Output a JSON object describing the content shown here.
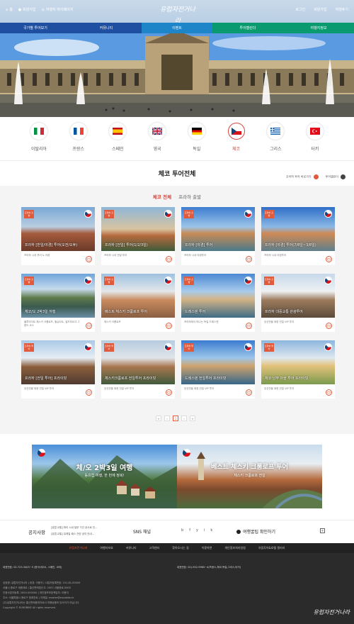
{
  "header": {
    "util_left": [
      "홈",
      "회원가입",
      "여행자 마이페이지"
    ],
    "logo_text": "유럽자전거나라",
    "util_right": [
      "로그인",
      "회원가입",
      "여행후기"
    ]
  },
  "gnb": {
    "items": [
      {
        "label": "국가별 투어보기",
        "color": "#1f4fa0"
      },
      {
        "label": "커뮤니티",
        "color": "#1f4fa0"
      },
      {
        "label": "이벤트",
        "color": "#1e86c8"
      },
      {
        "label": "투어캘린더",
        "color": "#0a9a6f"
      },
      {
        "label": "여행지정보",
        "color": "#0a9a6f"
      }
    ]
  },
  "countries": [
    {
      "label": "이탈리아",
      "active": false
    },
    {
      "label": "프랑스",
      "active": false
    },
    {
      "label": "스페인",
      "active": false
    },
    {
      "label": "영국",
      "active": false
    },
    {
      "label": "독일",
      "active": false
    },
    {
      "label": "체코",
      "active": true
    },
    {
      "label": "그리스",
      "active": false
    },
    {
      "label": "터키",
      "active": false
    }
  ],
  "section_title": "체코 투어전체",
  "top_links": {
    "link1": "프라하 투어 바로가기",
    "link2": "투어캘린더"
  },
  "filter": {
    "tab_all": "체코 전체",
    "tab_prague": "프라하 출발"
  },
  "cards": [
    {
      "badge": "프라하 출발",
      "title": "프라하 [반일/야경] 투어(오전/오후)",
      "sub": "프라하 시내 투어 & 야경"
    },
    {
      "badge": "프라하 출발",
      "title": "프라하 [전일] 투어(1/2/3일)",
      "sub": "프라하 시내 전일 투어"
    },
    {
      "badge": "프라하 출발",
      "title": "프라하 [야경] 투어",
      "sub": "프라하 시내 야경투어"
    },
    {
      "badge": "프라하 출발",
      "title": "프라하 [야경] 투어(7/8일~3/8일)",
      "sub": "프라하 시내 야경투어"
    },
    {
      "badge": "프라하 출발",
      "title": "체코/오 2박3일 여행",
      "sub": "블루라이트 체스키 크룸로프, 할슈타트, 잘츠부르크 그랜드 코스"
    },
    {
      "badge": "프라하 출발",
      "title": "베스트 체스키 크룸로프 투어",
      "sub": "체스키 크룸로프"
    },
    {
      "badge": "프라하 출발",
      "title": "드레스덴 투어",
      "sub": "프라하에서 떠나는 독일 드레스덴"
    },
    {
      "badge": "프라하 출발",
      "title": "프라하 대중교통 관광투어",
      "sub": "당신만을 위한 전일 VIP 투어"
    },
    {
      "badge": "프라하 투어",
      "title": "프라하 [전일 투어] 프라이빗",
      "sub": "당신만을 위한 전일 VIP 투어"
    },
    {
      "badge": "프라하 투어",
      "title": "체스키크룸로프 전일투어 프라이빗",
      "sub": "당신만을 위한 전일 VIP 투어"
    },
    {
      "badge": "프라하 투어",
      "title": "드레스덴 전일투어 프라이빗",
      "sub": "당신만을 위한 전일 VIP 투어"
    },
    {
      "badge": "프라하 투어",
      "title": "체코 남부 마을 투어 프라이빗",
      "sub": "당신만을 위한 전일 VIP 투어"
    }
  ],
  "pager": {
    "prev_first": "«",
    "prev": "‹",
    "current": "1",
    "next": "›",
    "next_last": "»"
  },
  "banners": [
    {
      "title": "체/오 2박3일 여행",
      "subtitle": "동유럽 여행, 한 번에 정복!"
    },
    {
      "title": "베스트 체스키 크룸로프 투어",
      "subtitle": "체스키 크룸로프 전일"
    }
  ],
  "notice": {
    "title": "공지사항",
    "items": [
      "[유럽 교통] 파리 시내 일부 구간 공사로 인...",
      "[유럽 교통] 유레일 패스 관련 공지 안내..."
    ]
  },
  "sns": {
    "title": "SNS 채널",
    "icons": [
      "b",
      "f",
      "y",
      "i",
      "k"
    ]
  },
  "tip": {
    "label": "여행꿀팁 확인하기"
  },
  "footer": {
    "nav": [
      "유럽자전거나라",
      "여행자보호",
      "커뮤니티",
      "고객센터",
      "찾아오시는 길",
      "이용약관",
      "개인정보처리방침",
      "유럽투어&호텔 갤러리"
    ],
    "phone_label1": "대표번호:",
    "phone_value1": "02-723-3403~5 (한국사무소, 스페인, 코리)",
    "phone_label2": "대표번호:",
    "phone_value2": "02)-952-9965~4(프랑스,체코,독일,그리스,터키)",
    "info_lines": [
      "상호명: 유럽자전거나라 | 대표: 이용석 | 사업자등록번호: 101-81-00000",
      "서울시 종로구 세종대로 | 통신판매업신고: 2007-서울종로-0000",
      "관광사업자등록: 2000-000000 | 개인정보보호책임자: 이용석",
      "주소: 서울특별시 종로구 청계천로 | 이메일: master@eurobike.kr",
      "(주)유럽자전거나라는 통신판매중개자로서 여행상품의 당사자가 아닙니다.",
      "Copyright © EUROBIKE All rights reserved."
    ],
    "logo_text": "유럽자전거나라"
  }
}
